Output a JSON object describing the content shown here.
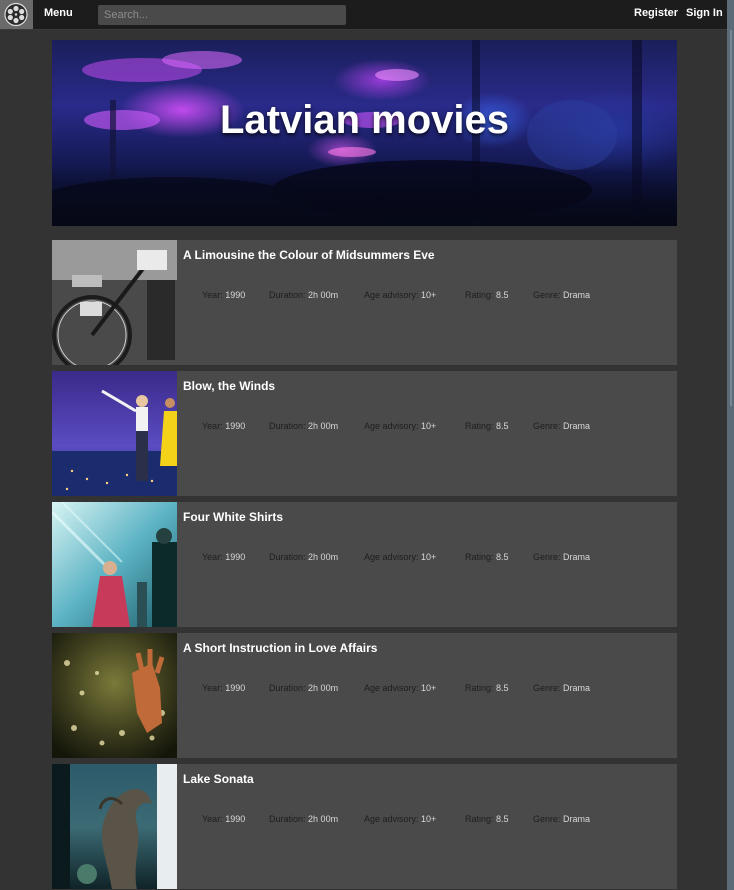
{
  "header": {
    "menu_label": "Menu",
    "search_placeholder": "Search...",
    "register_label": "Register",
    "signin_label": "Sign In"
  },
  "hero": {
    "title": "Latvian movies"
  },
  "meta_labels": {
    "year": "Year:",
    "duration": "Duration:",
    "age": "Age advisory:",
    "rating": "Rating:",
    "genre": "Genre:"
  },
  "movies": [
    {
      "title": "A Limousine the Colour of Midsummers Eve",
      "year": "1990",
      "duration": "2h 00m",
      "age": "10+",
      "rating": "8.5",
      "genre": "Drama",
      "poster": "bicycle-photo"
    },
    {
      "title": "Blow, the Winds",
      "year": "1990",
      "duration": "2h 00m",
      "age": "10+",
      "rating": "8.5",
      "genre": "Drama",
      "poster": "dancing-couple-photo"
    },
    {
      "title": "Four White Shirts",
      "year": "1990",
      "duration": "2h 00m",
      "age": "10+",
      "rating": "8.5",
      "genre": "Drama",
      "poster": "matrix-scene-photo"
    },
    {
      "title": "A Short Instruction in Love Affairs",
      "year": "1990",
      "duration": "2h 00m",
      "age": "10+",
      "rating": "8.5",
      "genre": "Drama",
      "poster": "hand-underwater-photo"
    },
    {
      "title": "Lake Sonata",
      "year": "1990",
      "duration": "2h 00m",
      "age": "10+",
      "rating": "8.5",
      "genre": "Drama",
      "poster": "tree-creature-photo"
    }
  ]
}
